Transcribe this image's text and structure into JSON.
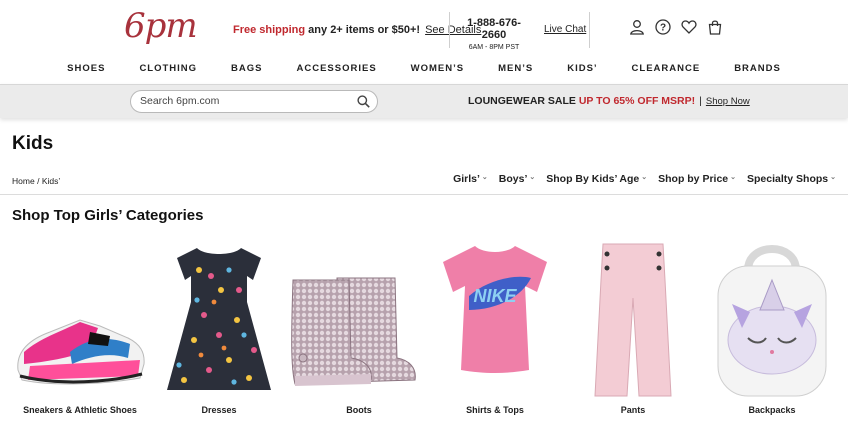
{
  "brand": {
    "logo_text": "6pm",
    "color": "#a8323c"
  },
  "header": {
    "shipping_red": "Free shipping",
    "shipping_rest": " any 2+ items or $50+!",
    "see_details": "See Details",
    "phone": "1-888-676-2660",
    "hours": "6AM - 8PM PST",
    "live_chat": "Live Chat",
    "icons": [
      "account-icon",
      "help-icon",
      "heart-icon",
      "bag-icon"
    ]
  },
  "nav": [
    "SHOES",
    "CLOTHING",
    "BAGS",
    "ACCESSORIES",
    "WOMEN’S",
    "MEN’S",
    "KIDS’",
    "CLEARANCE",
    "BRANDS"
  ],
  "search": {
    "placeholder": "Search 6pm.com"
  },
  "promo": {
    "label": "LOUNGEWEAR SALE",
    "discount": "UP TO 65% OFF MSRP!",
    "sep": "|",
    "cta": "Shop Now"
  },
  "page": {
    "title": "Kids",
    "breadcrumb": {
      "home": "Home",
      "sep": "/",
      "current": "Kids’"
    },
    "filters": [
      "Girls’",
      "Boys’",
      "Shop By Kids’ Age",
      "Shop by Price",
      "Specialty Shops"
    ],
    "section_title": "Shop Top Girls’ Categories"
  },
  "categories": [
    {
      "label": "Sneakers & Athletic Shoes"
    },
    {
      "label": "Dresses"
    },
    {
      "label": "Boots"
    },
    {
      "label": "Shirts & Tops"
    },
    {
      "label": "Pants"
    },
    {
      "label": "Backpacks"
    }
  ],
  "colors": {
    "accent_red": "#c0282e",
    "bar_bg": "#ebebeb"
  }
}
